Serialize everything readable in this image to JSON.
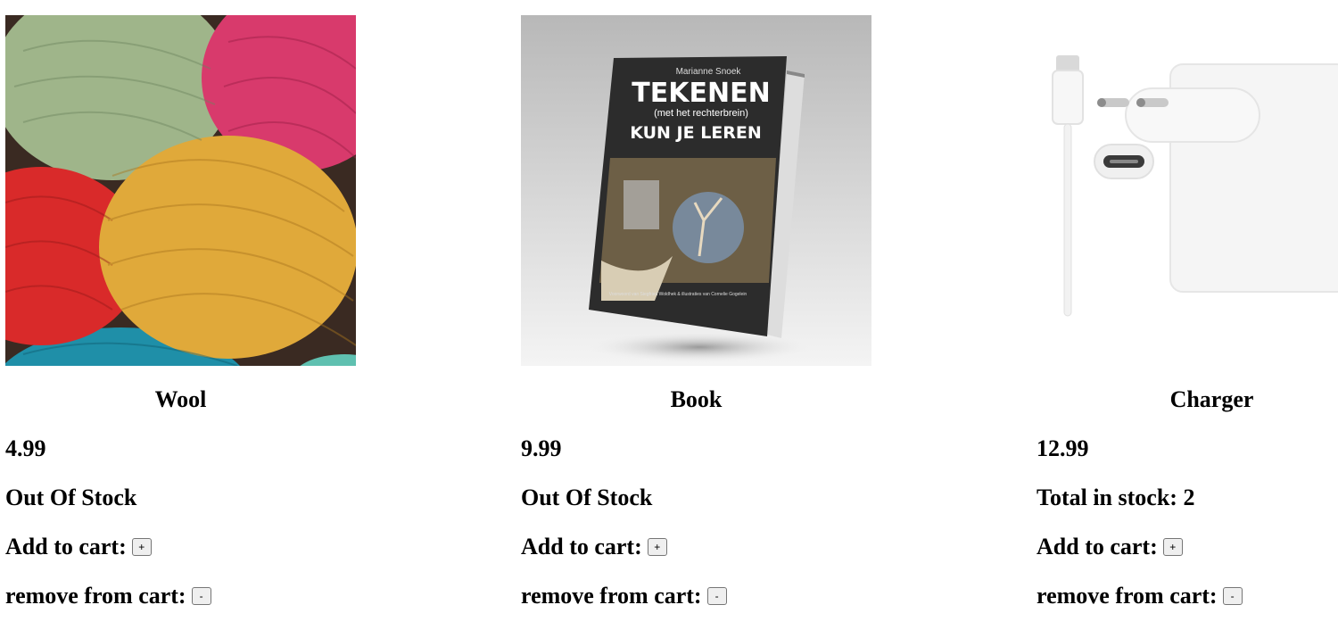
{
  "products": [
    {
      "image_icon": "yarn-balls-image",
      "name": "Wool",
      "price": "4.99",
      "stock_text": "Out Of Stock",
      "add_label": "Add to cart:",
      "add_button": "+",
      "remove_label": "remove from cart:",
      "remove_button": "-"
    },
    {
      "image_icon": "book-image",
      "name": "Book",
      "price": "9.99",
      "stock_text": "Out Of Stock",
      "add_label": "Add to cart:",
      "add_button": "+",
      "remove_label": "remove from cart:",
      "remove_button": "-",
      "cover": {
        "author": "Marianne Snoek",
        "title_line1": "TEKENEN",
        "title_line2": "(met het rechterbrein)",
        "title_line3": "KUN JE LEREN",
        "footer": "Voorwoord van Siegfried Woldhek & illustraties van Cornelie Gogelein"
      }
    },
    {
      "image_icon": "usb-c-charger-image",
      "name": "Charger",
      "price": "12.99",
      "stock_text": "Total in stock: 2",
      "add_label": "Add to cart:",
      "add_button": "+",
      "remove_label": "remove from cart:",
      "remove_button": "-"
    }
  ]
}
